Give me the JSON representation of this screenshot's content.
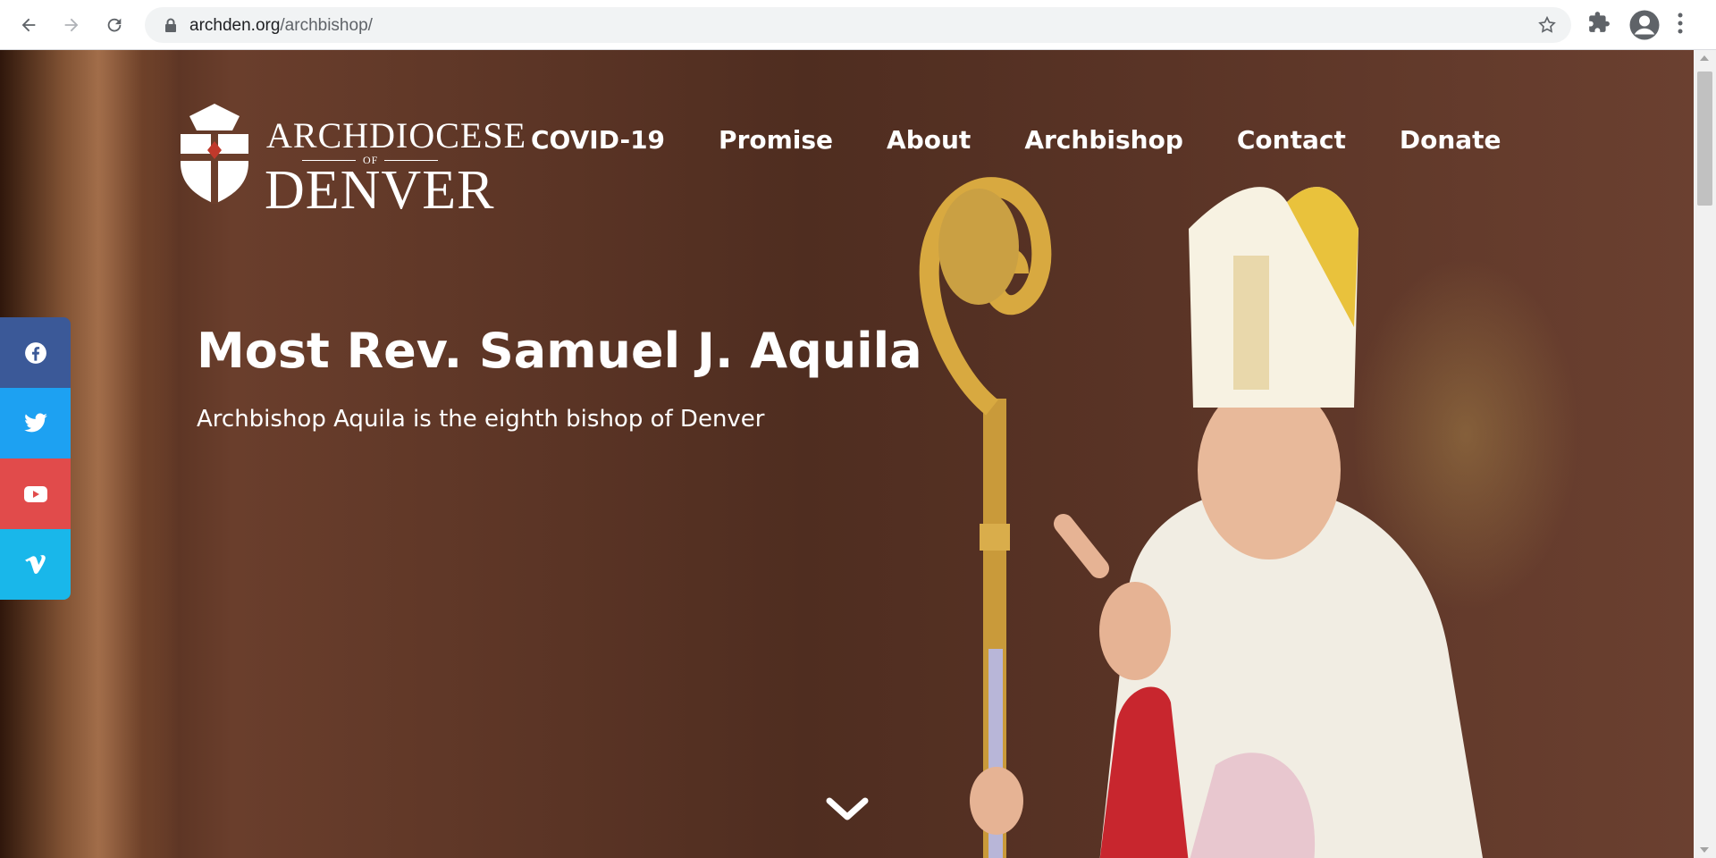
{
  "browser": {
    "url_host": "archden.org",
    "url_path": "/archbishop/",
    "icons": [
      "back-icon",
      "forward-icon",
      "reload-icon",
      "lock-icon",
      "star-icon",
      "extensions-icon",
      "profile-icon",
      "menu-icon"
    ]
  },
  "logo": {
    "line1": "ARCHDIOCESE",
    "of": "OF",
    "line2": "DENVER"
  },
  "nav": {
    "items": [
      {
        "label": "COVID-19"
      },
      {
        "label": "Promise"
      },
      {
        "label": "About"
      },
      {
        "label": "Archbishop"
      },
      {
        "label": "Contact"
      },
      {
        "label": "Donate"
      }
    ]
  },
  "hero": {
    "title": "Most Rev. Samuel J. Aquila",
    "subtitle": "Archbishop Aquila is the eighth bishop of Denver"
  },
  "social": {
    "items": [
      {
        "name": "facebook-icon",
        "color": "#3b5998"
      },
      {
        "name": "twitter-icon",
        "color": "#1da1f2"
      },
      {
        "name": "youtube-icon",
        "color": "#e14b4b"
      },
      {
        "name": "vimeo-icon",
        "color": "#19b7ea"
      }
    ]
  },
  "colors": {
    "hero_bg": "#5a3426",
    "text": "#ffffff"
  }
}
